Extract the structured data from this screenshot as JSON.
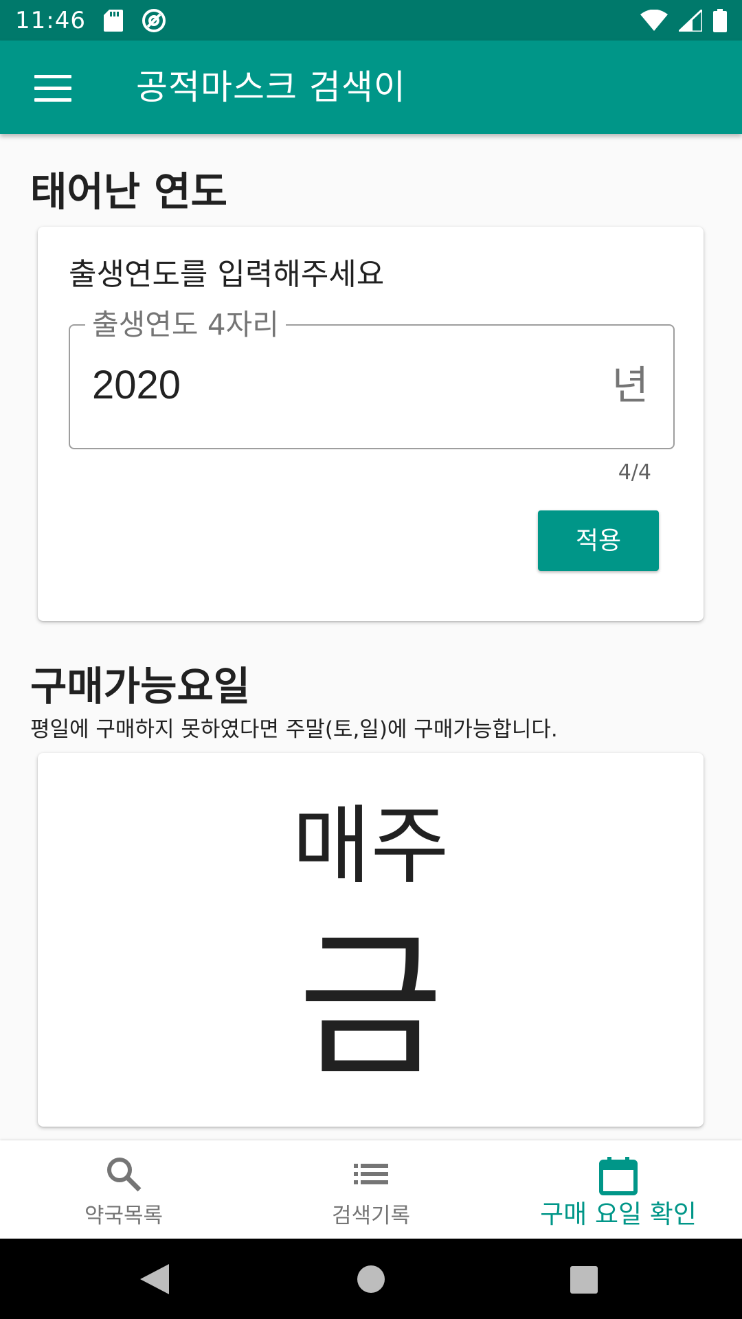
{
  "status_bar": {
    "time": "11:46"
  },
  "app_bar": {
    "title": "공적마스크 검색이"
  },
  "birth_year_section": {
    "title": "태어난 연도",
    "prompt": "출생연도를 입력해주세요",
    "field_label": "출생연도 4자리",
    "field_value": "2020",
    "field_suffix": "년",
    "counter": "4/4",
    "apply_label": "적용"
  },
  "purchase_section": {
    "title": "구매가능요일",
    "subtitle": "평일에 구매하지 못하였다면 주말(토,일)에 구매가능합니다.",
    "weekly_label": "매주",
    "day_label": "금"
  },
  "bottom_nav": {
    "items": [
      {
        "label": "약국목록",
        "icon": "search-icon",
        "active": false
      },
      {
        "label": "검색기록",
        "icon": "list-icon",
        "active": false
      },
      {
        "label": "구매 요일 확인",
        "icon": "calendar-icon",
        "active": true
      }
    ]
  },
  "colors": {
    "primary": "#009688",
    "primary_dark": "#00796b",
    "nav_inactive": "#757575"
  }
}
